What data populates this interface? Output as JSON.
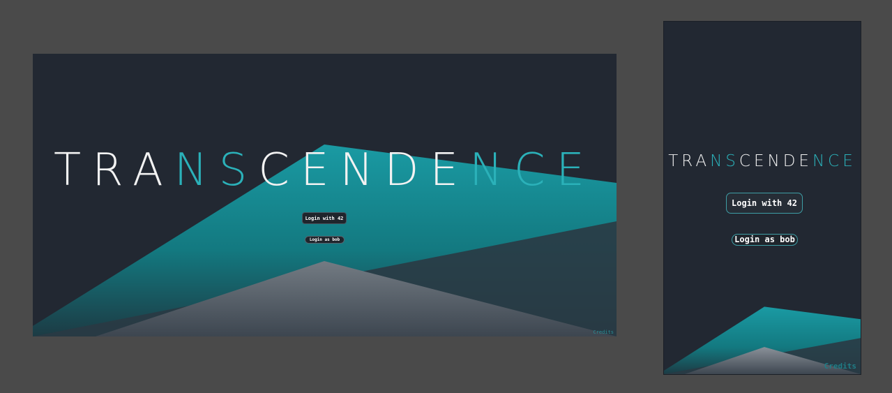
{
  "app": {
    "logo_parts": [
      "TRA",
      "N",
      "S",
      "CENDE",
      "N",
      "CE"
    ],
    "login_42_label": "Login with 42",
    "login_bob_label": "Login as bob",
    "credits_label": "Credits"
  },
  "colors": {
    "background": "#222832",
    "accent": "#2bb1b9",
    "canvas": "#4a4a4a"
  }
}
